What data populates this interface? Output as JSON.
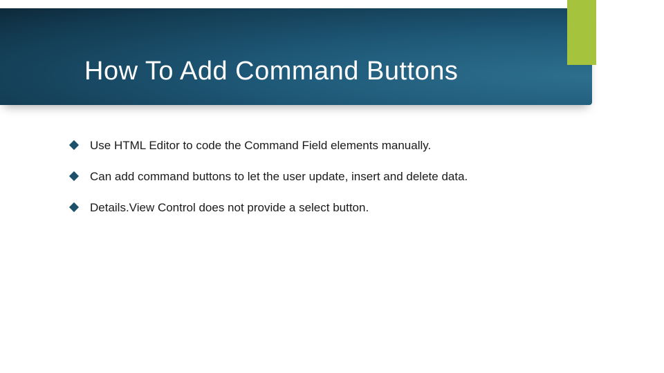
{
  "slide": {
    "title": "How To Add Command Buttons",
    "bullets": [
      "Use HTML Editor to code the Command Field elements manually.",
      "Can add command buttons to let the user update, insert and delete data.",
      "Details.View Control does not provide a select button."
    ],
    "colors": {
      "accent": "#a6c33d",
      "band_dark": "#0a1c28",
      "band_light": "#2e6f8e",
      "bullet_diamond": "#1d5069"
    }
  }
}
